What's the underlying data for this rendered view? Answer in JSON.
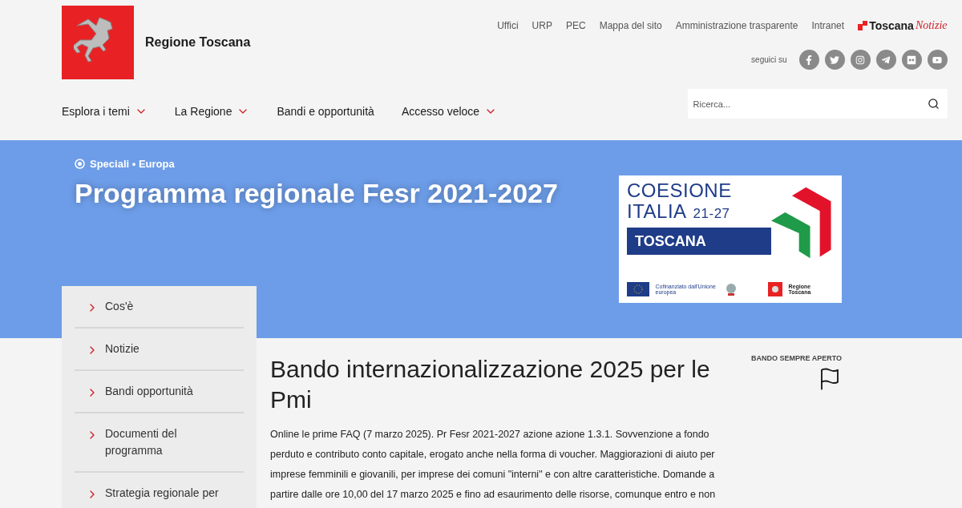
{
  "header": {
    "site_name": "Regione Toscana",
    "top_links": [
      "Uffici",
      "URP",
      "PEC",
      "Mappa del sito",
      "Amministrazione trasparente",
      "Intranet"
    ],
    "news_brand": {
      "bold": "Toscana",
      "italic": "Notizie"
    },
    "follow_label": "seguici su",
    "social": [
      {
        "kind": "facebook"
      },
      {
        "kind": "twitter"
      },
      {
        "kind": "instagram"
      },
      {
        "kind": "telegram"
      },
      {
        "kind": "flickr"
      },
      {
        "kind": "youtube"
      }
    ],
    "nav": [
      {
        "label": "Esplora i temi",
        "dropdown": true
      },
      {
        "label": "La Regione",
        "dropdown": true
      },
      {
        "label": "Bandi e opportunità",
        "dropdown": false
      },
      {
        "label": "Accesso veloce",
        "dropdown": true
      }
    ],
    "search": {
      "placeholder": "Ricerca..."
    }
  },
  "banner": {
    "breadcrumb": "Speciali • Europa",
    "title": "Programma regionale Fesr 2021-2027",
    "logo": {
      "line1": "COESIONE",
      "line2": "ITALIA",
      "years": "21-27",
      "region": "TOSCANA",
      "eu_text": "Cofinanziato dall'Unione europea",
      "region_text": "Regione Toscana"
    }
  },
  "sidebar": {
    "items": [
      "Cos'è",
      "Notizie",
      "Bandi opportunità",
      "Documenti del programma",
      "Strategia regionale per"
    ]
  },
  "article": {
    "status": "BANDO SEMPRE APERTO",
    "title": "Bando internazionalizzazione 2025 per le Pmi",
    "body": "Online le prime FAQ (7 marzo 2025). Pr Fesr 2021-2027 azione azione 1.3.1. Sovvenzione a fondo perduto e contributo conto capitale, erogato anche nella forma di voucher. Maggiorazioni di aiuto per imprese femminili e giovanili, per imprese dei comuni \"interni\" e con altre caratteristiche. Domande a partire dalle ore 10,00 del 17 marzo 2025 e fino ad esaurimento delle risorse, comunque entro e non"
  }
}
